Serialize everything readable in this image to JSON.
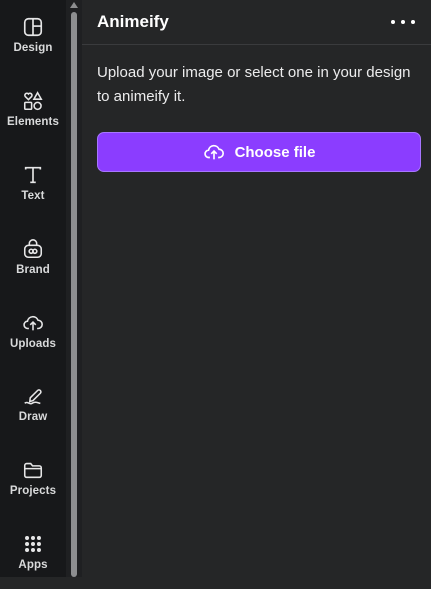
{
  "sidebar": {
    "items": [
      {
        "label": "Design",
        "icon": "design-icon"
      },
      {
        "label": "Elements",
        "icon": "elements-icon"
      },
      {
        "label": "Text",
        "icon": "text-icon"
      },
      {
        "label": "Brand",
        "icon": "brand-icon"
      },
      {
        "label": "Uploads",
        "icon": "uploads-icon"
      },
      {
        "label": "Draw",
        "icon": "draw-icon"
      },
      {
        "label": "Projects",
        "icon": "projects-icon"
      },
      {
        "label": "Apps",
        "icon": "apps-icon"
      }
    ]
  },
  "panel": {
    "title": "Animeify",
    "more_icon": "more-options-icon",
    "description": "Upload your image or select one in your design to animeify it.",
    "choose_button": {
      "label": "Choose file",
      "icon": "cloud-upload-icon"
    }
  },
  "colors": {
    "rail_bg": "#17181a",
    "panel_bg": "#252627",
    "accent": "#8b3dff"
  }
}
